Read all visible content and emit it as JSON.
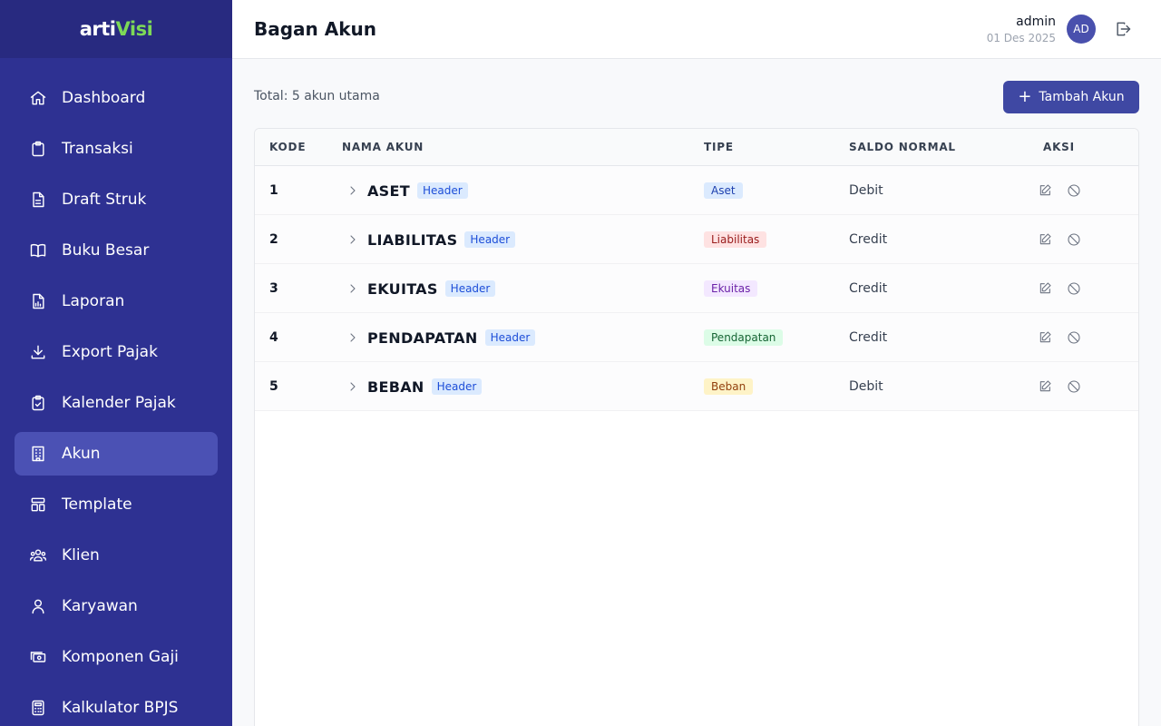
{
  "app": {
    "logo_main": "arti",
    "logo_accent": "Visi",
    "logo_tail": ""
  },
  "sidebar": {
    "items": [
      {
        "label": "Dashboard",
        "icon": "home-icon"
      },
      {
        "label": "Transaksi",
        "icon": "clipboard-icon"
      },
      {
        "label": "Draft Struk",
        "icon": "document-icon"
      },
      {
        "label": "Buku Besar",
        "icon": "book-icon"
      },
      {
        "label": "Laporan",
        "icon": "report-icon"
      },
      {
        "label": "Export Pajak",
        "icon": "download-icon"
      },
      {
        "label": "Kalender Pajak",
        "icon": "clipboard-check-icon"
      },
      {
        "label": "Akun",
        "icon": "building-icon",
        "active": true
      },
      {
        "label": "Template",
        "icon": "template-icon"
      },
      {
        "label": "Klien",
        "icon": "users-icon"
      },
      {
        "label": "Karyawan",
        "icon": "user-icon"
      },
      {
        "label": "Komponen Gaji",
        "icon": "cash-icon"
      },
      {
        "label": "Kalkulator BPJS",
        "icon": "calculator-icon"
      }
    ]
  },
  "header": {
    "title": "Bagan Akun",
    "user_name": "admin",
    "date": "01 Des 2025",
    "avatar_initials": "AD",
    "logout_icon": "logout-icon"
  },
  "main": {
    "summary": "Total: 5 akun utama",
    "add_button_label": "Tambah Akun",
    "table": {
      "columns": {
        "code": "KODE",
        "name": "NAMA AKUN",
        "type": "TIPE",
        "saldo": "SALDO NORMAL",
        "actions": "AKSI"
      },
      "rows": [
        {
          "code": "1",
          "name": "ASET",
          "badge": "Header",
          "type": "Aset",
          "saldo": "Debit"
        },
        {
          "code": "2",
          "name": "LIABILITAS",
          "badge": "Header",
          "type": "Liabilitas",
          "saldo": "Credit"
        },
        {
          "code": "3",
          "name": "EKUITAS",
          "badge": "Header",
          "type": "Ekuitas",
          "saldo": "Credit"
        },
        {
          "code": "4",
          "name": "PENDAPATAN",
          "badge": "Header",
          "type": "Pendapatan",
          "saldo": "Credit"
        },
        {
          "code": "5",
          "name": "BEBAN",
          "badge": "Header",
          "type": "Beban",
          "saldo": "Debit"
        }
      ]
    }
  },
  "colors": {
    "sidebar_bg": "#2e3192",
    "sidebar_active": "#4b51b4",
    "primary_button": "#3f48a3",
    "type_aset": {
      "bg": "#dbeafe",
      "fg": "#1e40af"
    },
    "type_liabilitas": {
      "bg": "#fee2e2",
      "fg": "#991b1b"
    },
    "type_ekuitas": {
      "bg": "#f3e8ff",
      "fg": "#6b21a8"
    },
    "type_pendapatan": {
      "bg": "#dcfce7",
      "fg": "#166534"
    },
    "type_beban": {
      "bg": "#fef3c7",
      "fg": "#92400e"
    }
  }
}
